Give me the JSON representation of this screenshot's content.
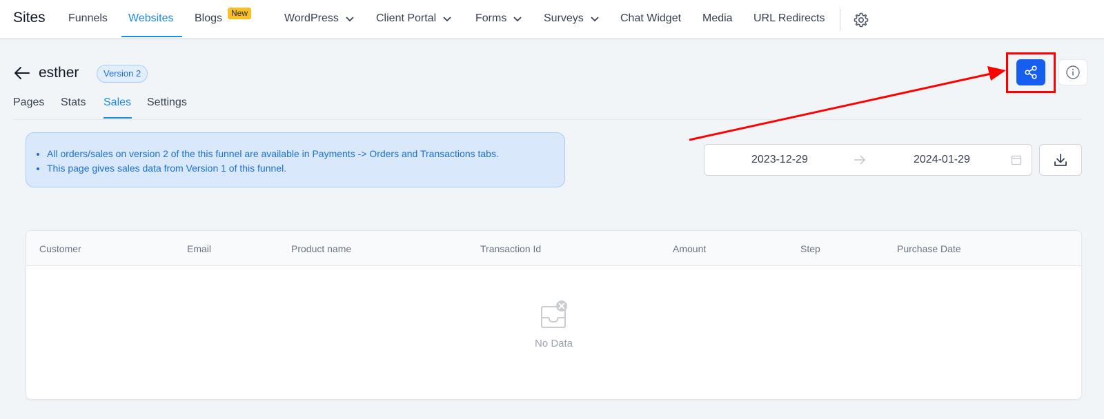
{
  "nav": {
    "brand": "Sites",
    "items": [
      {
        "label": "Funnels"
      },
      {
        "label": "Websites"
      },
      {
        "label": "Blogs"
      },
      {
        "label": "WordPress"
      },
      {
        "label": "Client Portal"
      },
      {
        "label": "Forms"
      },
      {
        "label": "Surveys"
      },
      {
        "label": "Chat Widget"
      },
      {
        "label": "Media"
      },
      {
        "label": "URL Redirects"
      }
    ],
    "active": "Websites",
    "new_badge": "New"
  },
  "header": {
    "funnel_name": "esther",
    "version": "Version 2"
  },
  "tabs": [
    {
      "label": "Pages"
    },
    {
      "label": "Stats"
    },
    {
      "label": "Sales"
    },
    {
      "label": "Settings"
    }
  ],
  "active_tab": "Sales",
  "notice": {
    "lines": [
      "All orders/sales on version 2 of the this funnel are available in Payments -> Orders and Transactions tabs.",
      "This page gives sales data from Version 1 of this funnel."
    ]
  },
  "date_range": {
    "start": "2023-12-29",
    "end": "2024-01-29"
  },
  "table": {
    "columns": [
      "Customer",
      "Email",
      "Product name",
      "Transaction Id",
      "Amount",
      "Step",
      "Purchase Date"
    ],
    "rows": [],
    "empty_text": "No Data"
  },
  "colors": {
    "accent": "#1c8ae4",
    "primary_button": "#155eef",
    "annotation": "#ff0000",
    "notice_bg": "#d9e8fb"
  },
  "icons": {
    "share": "share-icon",
    "info": "info-icon",
    "download": "download-icon",
    "settings": "gear-icon",
    "calendar": "calendar-icon"
  }
}
